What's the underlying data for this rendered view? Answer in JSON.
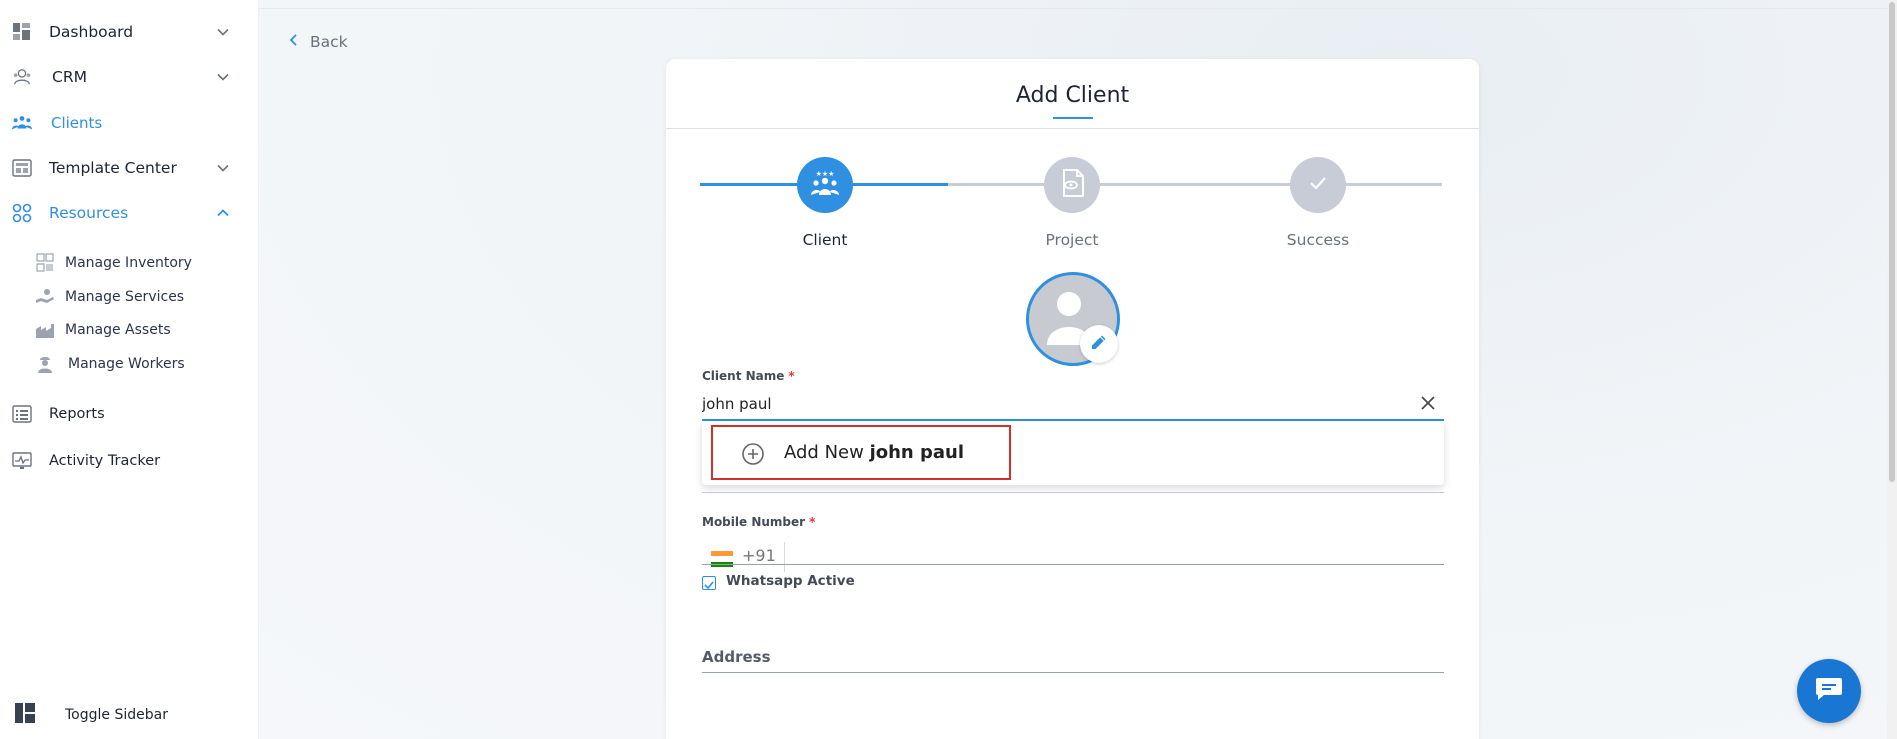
{
  "sidebar": {
    "items": [
      {
        "label": "Dashboard",
        "icon": "dashboard-icon",
        "has_chevron": true
      },
      {
        "label": "CRM",
        "icon": "crm-icon",
        "has_chevron": true
      },
      {
        "label": "Clients",
        "icon": "clients-icon",
        "active": true
      },
      {
        "label": "Template Center",
        "icon": "template-icon",
        "has_chevron": true
      },
      {
        "label": "Resources",
        "icon": "resources-icon",
        "active": true,
        "expanded": true
      },
      {
        "label": "Reports",
        "icon": "reports-icon"
      },
      {
        "label": "Activity Tracker",
        "icon": "activity-icon"
      }
    ],
    "sub_items": [
      {
        "label": "Manage Inventory",
        "icon": "inventory-icon"
      },
      {
        "label": "Manage Services",
        "icon": "services-icon"
      },
      {
        "label": "Manage Assets",
        "icon": "assets-icon"
      },
      {
        "label": "Manage Workers",
        "icon": "workers-icon"
      }
    ],
    "toggle_label": "Toggle Sidebar"
  },
  "header": {
    "back_label": "Back"
  },
  "card": {
    "title": "Add Client",
    "steps": [
      {
        "label": "Client",
        "state": "active"
      },
      {
        "label": "Project",
        "state": "pending"
      },
      {
        "label": "Success",
        "state": "pending"
      }
    ]
  },
  "form": {
    "client_name_label": "Client Name",
    "client_name_value": "john paul",
    "required_mark": "*",
    "dropdown_option_prefix": "Add New",
    "dropdown_option_bold": "john paul",
    "mobile_label": "Mobile Number",
    "dial_code": "+91",
    "whatsapp_label": "Whatsapp Active",
    "whatsapp_checked": true,
    "address_label": "Address"
  },
  "colors": {
    "accent": "#2f8fe0",
    "step_pending": "#c7ccd6",
    "chat_button": "#1976d2",
    "highlight_border": "#d32f2f"
  }
}
